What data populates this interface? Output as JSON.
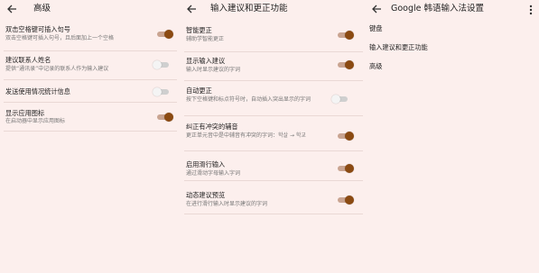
{
  "colors": {
    "background": "#fcefed",
    "toggle_on": "#8b4a12",
    "toggle_off": "#f4f4f4",
    "divider": "#ead8d5"
  },
  "panel1": {
    "title": "高级",
    "items": [
      {
        "label": "双击空格键可插入句号",
        "desc": "双击空格键可插入句号，且后面加上一个空格",
        "toggle": "on"
      },
      {
        "label": "建议联系人姓名",
        "desc": "提供“通讯录”中记录的联系人作为输入建议",
        "toggle": "off"
      },
      {
        "label": "发送使用情况统计信息",
        "desc": "",
        "toggle": "off"
      },
      {
        "label": "显示应用图标",
        "desc": "在启动器中显示应用图标",
        "toggle": "on"
      }
    ]
  },
  "panel2": {
    "title": "输入建议和更正功能",
    "items": [
      {
        "label": "智能更正",
        "desc": "辅助学智能更正",
        "toggle": "on"
      },
      {
        "label": "显示输入建议",
        "desc": "输入时显示建议的字词",
        "toggle": "on"
      },
      {
        "label": "自动更正",
        "desc": "按下空格键和标点符号时，自动插入突出显示的字词",
        "toggle": "off"
      },
      {
        "label": "纠正有冲突的辅音",
        "desc": "更正单元音中是中辅音有冲突的字词：학살 → 학교",
        "toggle": "on"
      },
      {
        "label": "启用滑行输入",
        "desc": "通过滑动字母输入字词",
        "toggle": "on"
      },
      {
        "label": "动态建议预览",
        "desc": "在进行滑行输入时显示建议的字词",
        "toggle": "on"
      }
    ]
  },
  "panel3": {
    "title": "Google 韩语输入法设置",
    "items": [
      "键盘",
      "输入建议和更正功能",
      "高级"
    ]
  },
  "icons": {
    "back": "arrow-left-icon",
    "more": "more-vert-icon"
  }
}
